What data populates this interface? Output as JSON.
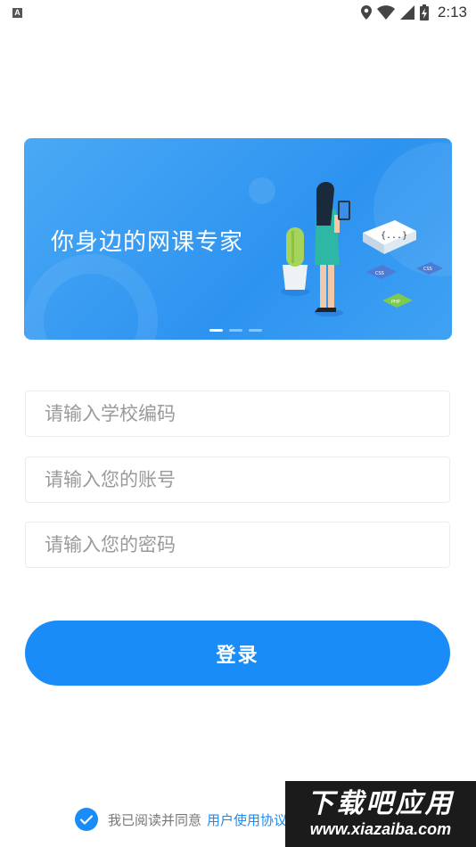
{
  "status_bar": {
    "notification_icon": "A",
    "time": "2:13",
    "icons": [
      "location-icon",
      "wifi-icon",
      "signal-icon",
      "battery-charging-icon"
    ]
  },
  "banner": {
    "slogan": "你身边的网课专家",
    "slide_count": 3,
    "active_slide": 1,
    "illustration_labels": {
      "board": "{...}",
      "card_css_1": "CSS",
      "card_css_2": "CSS",
      "card_php": "PHP"
    },
    "colors": {
      "background": "#2d93f0"
    }
  },
  "form": {
    "school_code": {
      "placeholder": "请输入学校编码",
      "value": ""
    },
    "account": {
      "placeholder": "请输入您的账号",
      "value": ""
    },
    "password": {
      "placeholder": "请输入您的密码",
      "value": ""
    },
    "login_label": "登录"
  },
  "agreement": {
    "checked": true,
    "text": "我已阅读并同意",
    "link": "用户使用协议和隐私政策"
  },
  "watermark": {
    "title": "下载吧应用",
    "url": "www.xiazaiba.com"
  },
  "colors": {
    "accent": "#1a8cf7",
    "placeholder": "#9a9a9a",
    "field_border": "#ececec"
  }
}
